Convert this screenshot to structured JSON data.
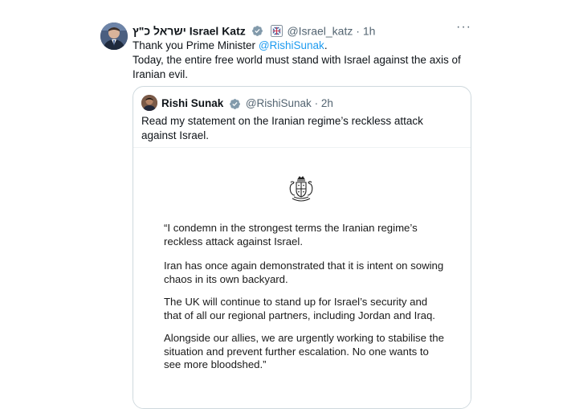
{
  "tweet": {
    "display_name": "ישראל כ\"ץ Israel Katz",
    "handle": "@Israel_katz",
    "dot": "·",
    "time": "1h",
    "more_label": "···",
    "line1_prefix": "Thank you Prime Minister ",
    "line1_mention": "@RishiSunak",
    "line1_suffix": ".",
    "line2": "Today, the entire free world must stand with Israel against the axis of Iranian evil."
  },
  "quoted": {
    "display_name": "Rishi Sunak",
    "handle": "@RishiSunak",
    "dot": "·",
    "time": "2h",
    "text": "Read my statement on the Iranian regime’s reckless attack against Israel.",
    "statement": [
      "“I condemn in the strongest terms the Iranian regime’s reckless attack against Israel.",
      "Iran has once again demonstrated that it is intent on sowing chaos in its own backyard.",
      "The UK will continue to stand up for Israel’s security and that of all our regional partners, including Jordan and Iraq.",
      "Alongside our allies, we are urgently working to stabilise the situation and prevent further escalation. No one wants to see more bloodshed.”"
    ]
  },
  "icons": {
    "verified": "verified-badge-icon",
    "affiliate": "government-affiliate-icon",
    "crest": "royal-coat-of-arms-icon",
    "more": "more-options-icon"
  },
  "colors": {
    "mention": "#1d9bf0",
    "verified_gray": "#829aab",
    "secondary_text": "#536471",
    "border": "#cfd9de"
  }
}
